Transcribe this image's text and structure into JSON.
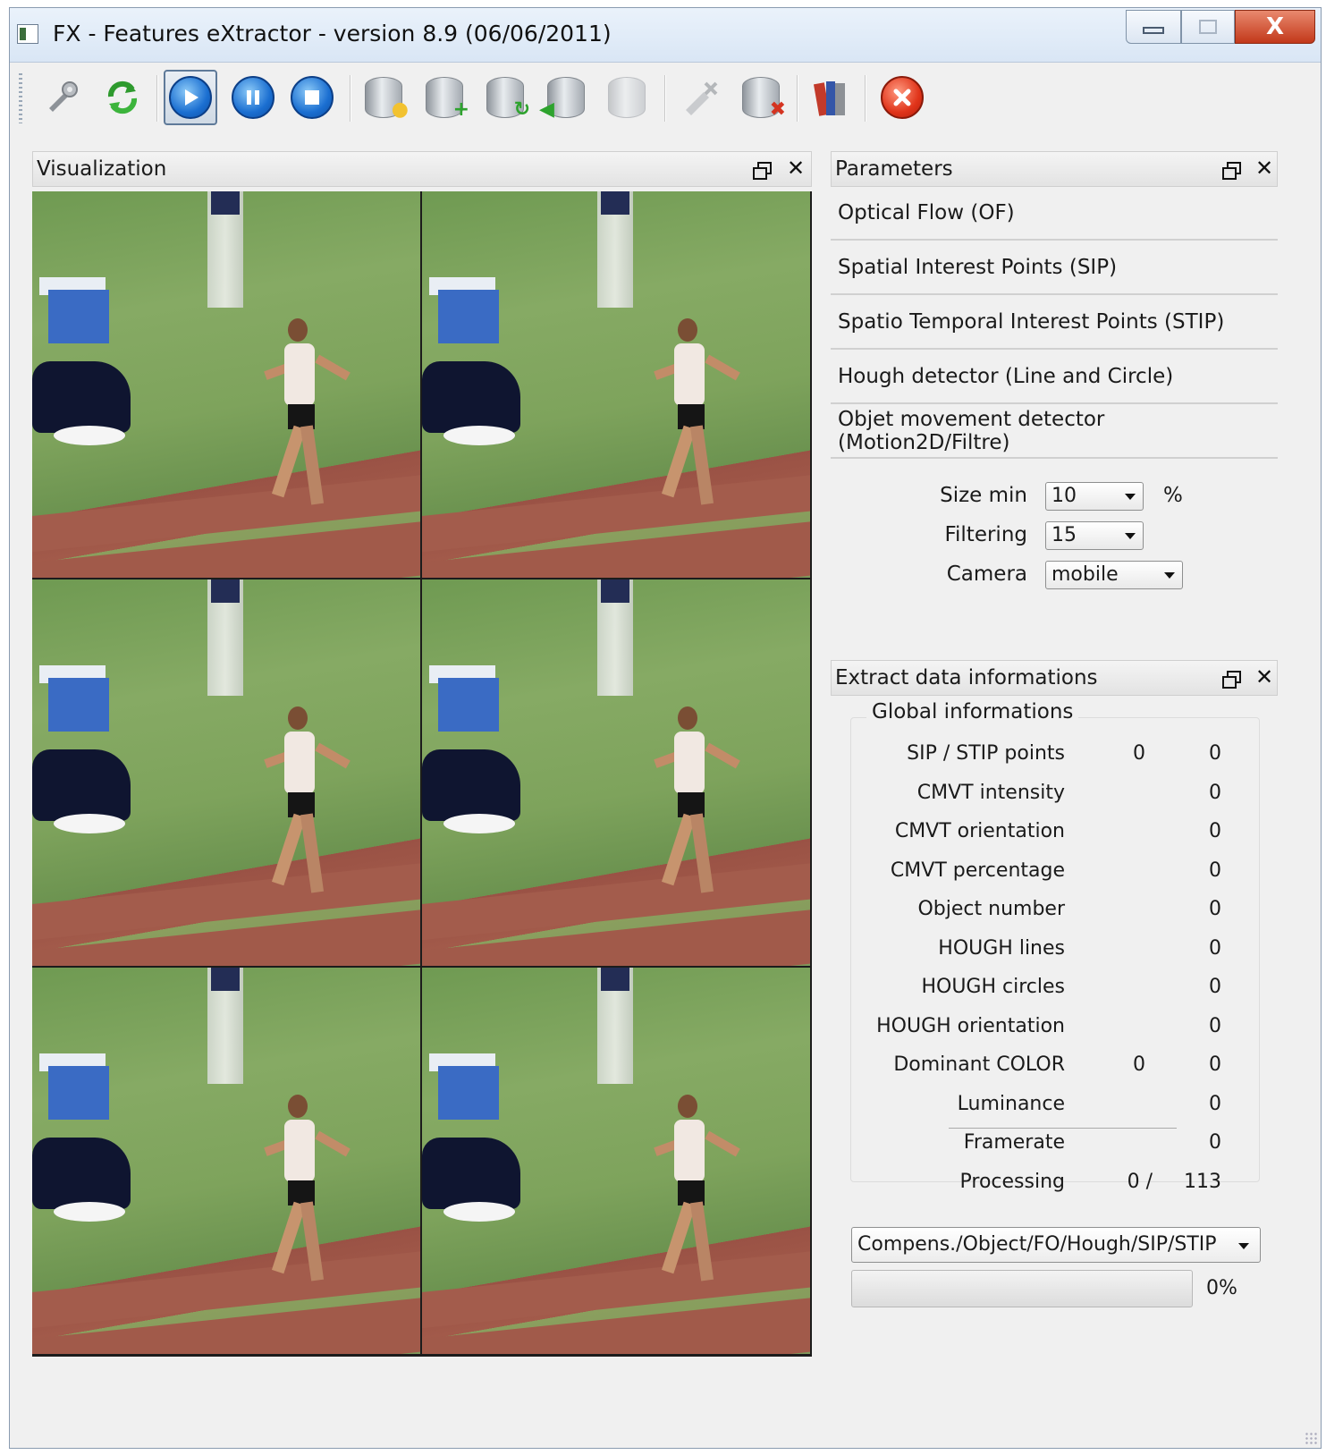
{
  "window": {
    "title": "FX - Features eXtractor - version 8.9 (06/06/2011)",
    "close_glyph": "X"
  },
  "toolbar": {
    "buttons": [
      {
        "name": "settings-tools-icon"
      },
      {
        "name": "refresh-icon"
      },
      {
        "name": "play-icon"
      },
      {
        "name": "pause-icon"
      },
      {
        "name": "stop-icon"
      },
      {
        "name": "database-light-icon"
      },
      {
        "name": "database-add-icon"
      },
      {
        "name": "database-refresh-icon"
      },
      {
        "name": "database-import-icon"
      },
      {
        "name": "database-icon"
      },
      {
        "name": "clear-icon"
      },
      {
        "name": "database-delete-icon"
      },
      {
        "name": "books-icon"
      },
      {
        "name": "exit-icon"
      }
    ]
  },
  "visualization": {
    "title": "Visualization",
    "tile_count": 6
  },
  "parameters": {
    "title": "Parameters",
    "items": [
      "Optical Flow (OF)",
      "Spatial Interest Points (SIP)",
      "Spatio Temporal Interest Points (STIP)",
      "Hough detector (Line and Circle)",
      "Objet movement detector (Motion2D/Filtre)"
    ],
    "size_min": {
      "label": "Size min",
      "value": "10",
      "unit": "%"
    },
    "filtering": {
      "label": "Filtering",
      "value": "15"
    },
    "camera": {
      "label": "Camera",
      "value": "mobile"
    }
  },
  "extract": {
    "title": "Extract data informations",
    "group_title": "Global informations",
    "rows": [
      {
        "label": "SIP / STIP points",
        "v1": "0",
        "v2": "0"
      },
      {
        "label": "CMVT intensity",
        "v1": "",
        "v2": "0"
      },
      {
        "label": "CMVT orientation",
        "v1": "",
        "v2": "0"
      },
      {
        "label": "CMVT percentage",
        "v1": "",
        "v2": "0"
      },
      {
        "label": "Object number",
        "v1": "",
        "v2": "0"
      },
      {
        "label": "HOUGH lines",
        "v1": "",
        "v2": "0"
      },
      {
        "label": "HOUGH circles",
        "v1": "",
        "v2": "0"
      },
      {
        "label": "HOUGH orientation",
        "v1": "",
        "v2": "0"
      },
      {
        "label": "Dominant COLOR",
        "v1": "0",
        "v2": "0"
      },
      {
        "label": "Luminance",
        "v1": "",
        "v2": "0"
      },
      {
        "label": "Framerate",
        "v1": "",
        "v2": "0"
      },
      {
        "label": "Processing",
        "v1": "0 /",
        "v2": "113"
      }
    ],
    "mode": "Compens./Object/FO/Hough/SIP/STIP",
    "progress": 0,
    "progress_text": "0%"
  }
}
